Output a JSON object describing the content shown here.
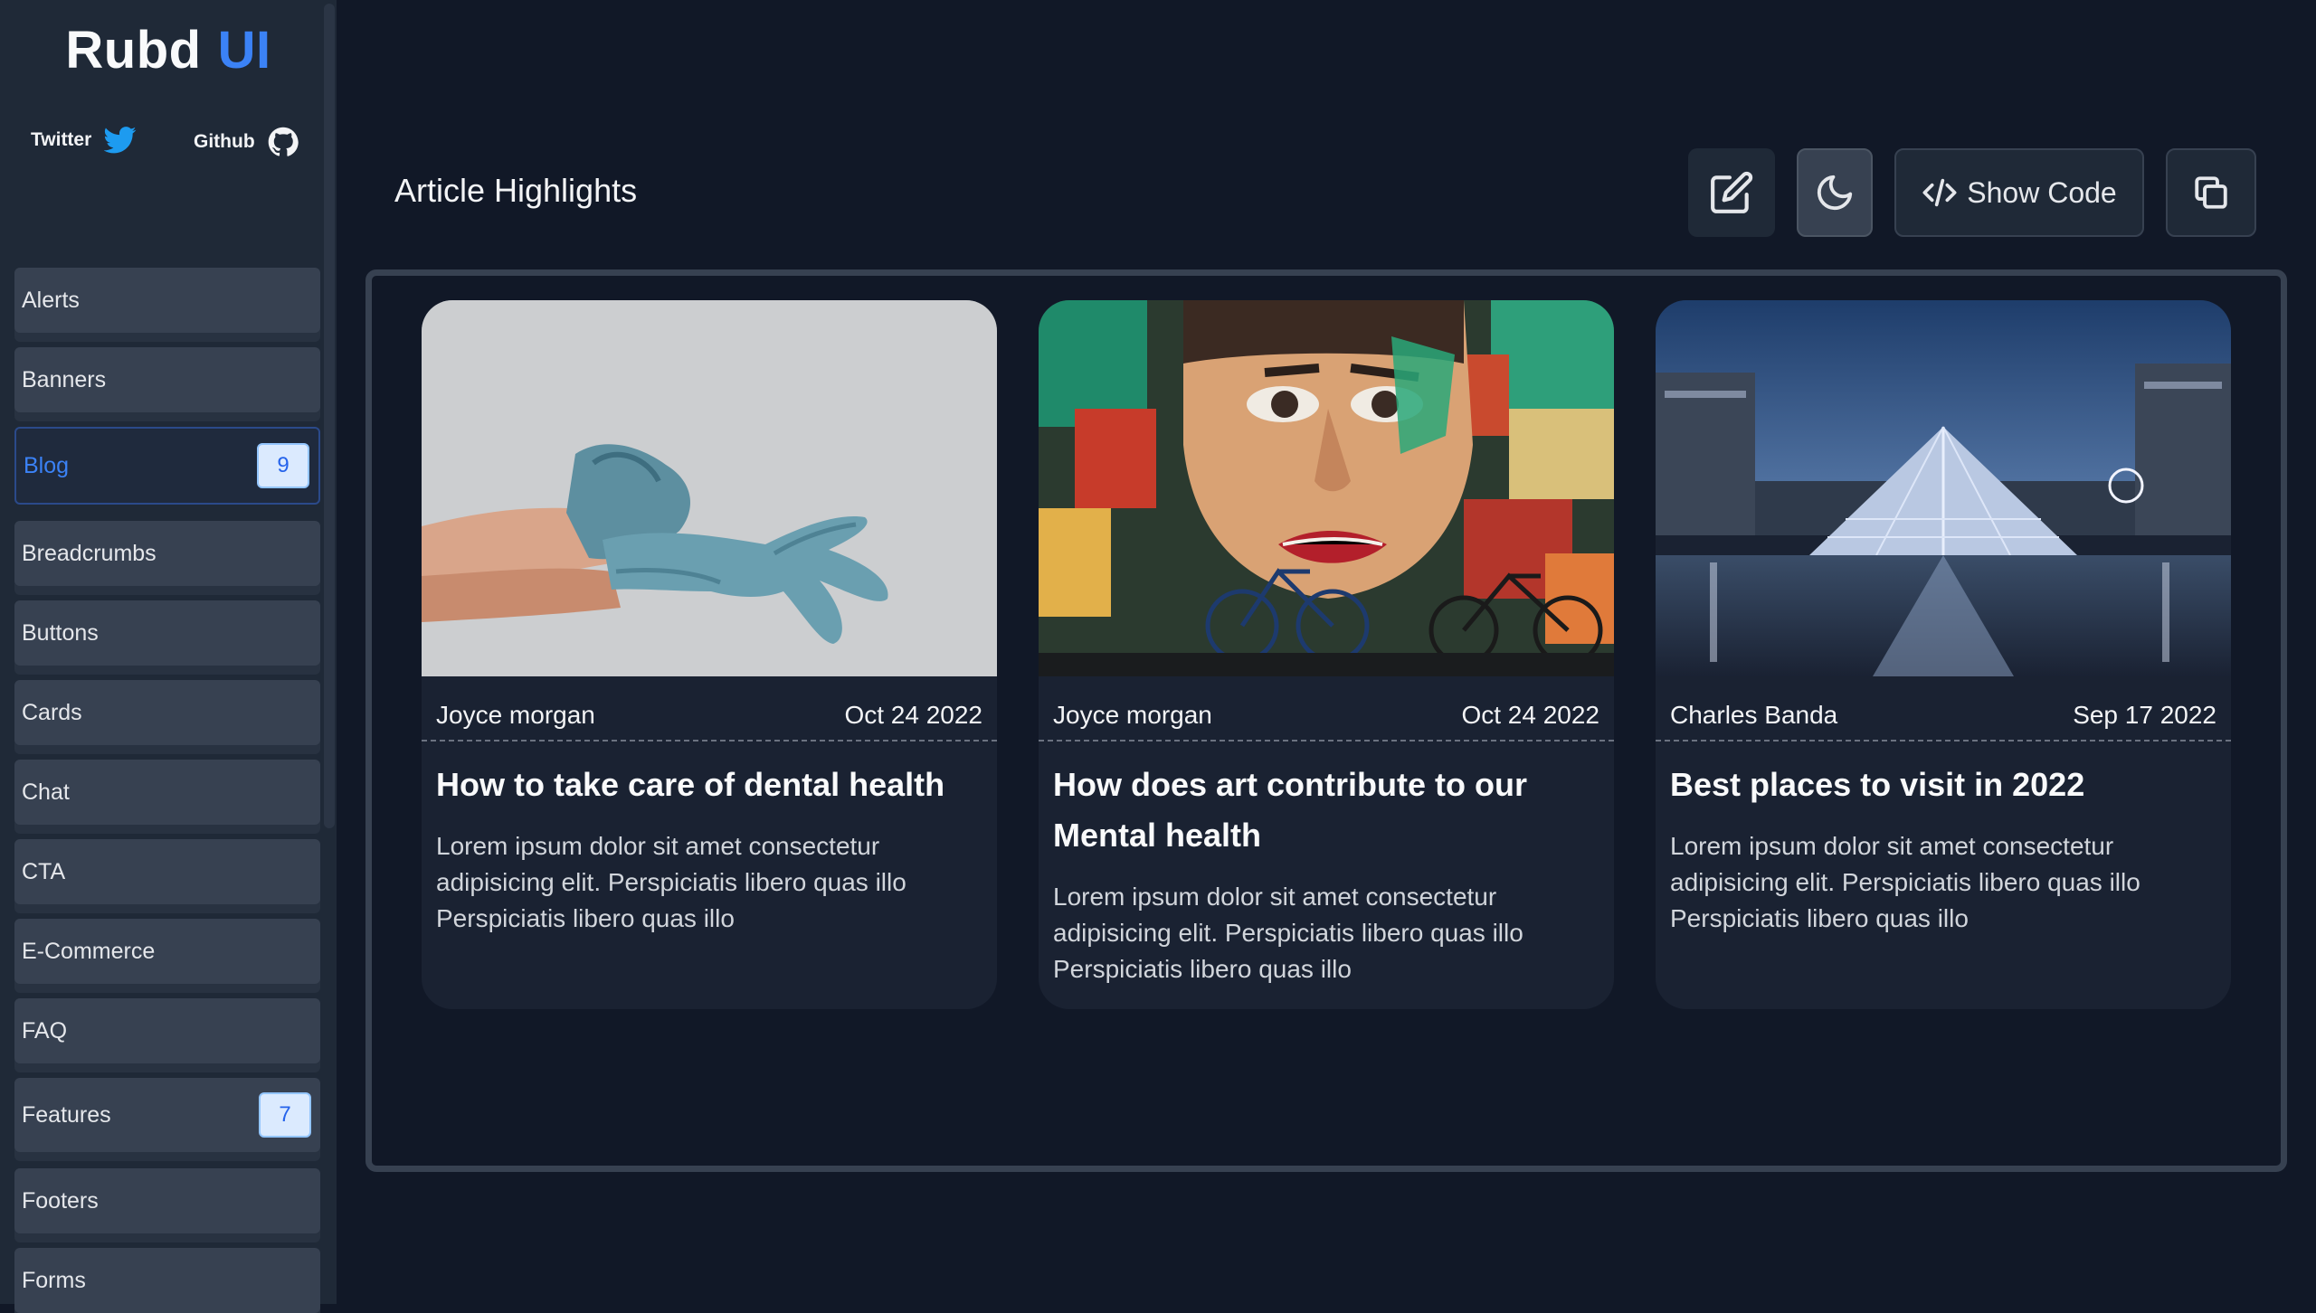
{
  "brand": {
    "name": "Rubd",
    "accent": "UI",
    "accent_color": "#3b82f6"
  },
  "social": [
    {
      "label": "Twitter",
      "icon": "twitter-icon"
    },
    {
      "label": "Github",
      "icon": "github-icon"
    }
  ],
  "sidebar": {
    "items": [
      {
        "label": "Alerts"
      },
      {
        "label": "Banners"
      },
      {
        "label": "Blog",
        "badge": "9",
        "active": true
      },
      {
        "label": "Breadcrumbs"
      },
      {
        "label": "Buttons"
      },
      {
        "label": "Cards"
      },
      {
        "label": "Chat"
      },
      {
        "label": "CTA"
      },
      {
        "label": "E-Commerce"
      },
      {
        "label": "FAQ"
      },
      {
        "label": "Features",
        "badge": "7"
      },
      {
        "label": "Footers"
      },
      {
        "label": "Forms"
      }
    ]
  },
  "header": {
    "title": "Article Highlights",
    "actions": [
      {
        "icon": "edit-icon"
      },
      {
        "icon": "moon-icon"
      },
      {
        "icon": "code-icon",
        "label": "Show Code"
      },
      {
        "icon": "copy-icon"
      }
    ]
  },
  "cards": [
    {
      "image": "gloved-hands-photo",
      "author": "Joyce morgan",
      "date": "Oct 24 2022",
      "title": "How to take care of dental health",
      "body": "Lorem ipsum dolor sit amet consectetur adipisicing elit. Perspiciatis libero quas illo Perspiciatis libero quas illo"
    },
    {
      "image": "street-art-mural-photo",
      "author": "Joyce morgan",
      "date": "Oct 24 2022",
      "title": "How does art contribute to our Mental health",
      "body": "Lorem ipsum dolor sit amet consectetur adipisicing elit. Perspiciatis libero quas illo Perspiciatis libero quas illo"
    },
    {
      "image": "louvre-pyramid-night-photo",
      "author": "Charles Banda",
      "date": "Sep 17 2022",
      "title": "Best places to visit in 2022",
      "body": "Lorem ipsum dolor sit amet consectetur adipisicing elit. Perspiciatis libero quas illo Perspiciatis libero quas illo"
    }
  ]
}
